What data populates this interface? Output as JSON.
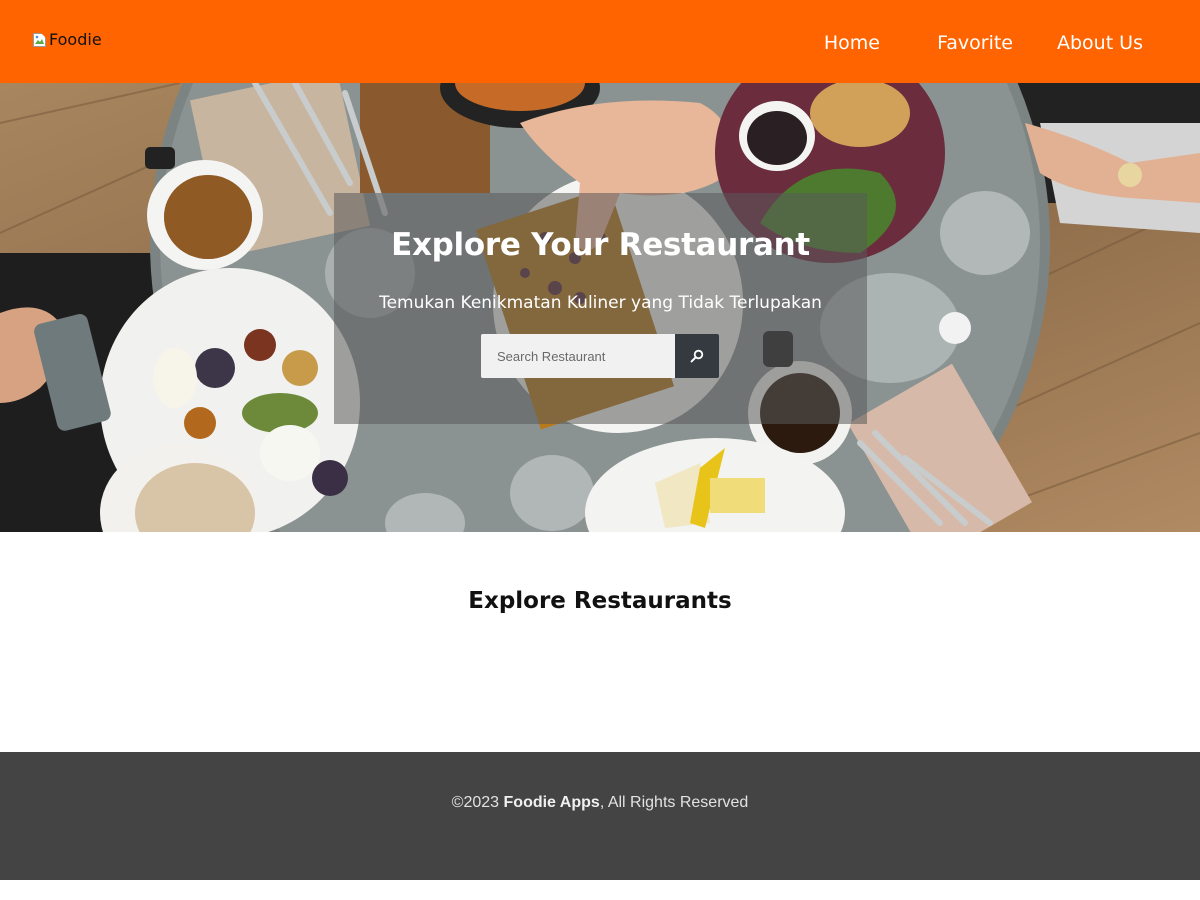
{
  "header": {
    "logo_alt": "Foodie",
    "nav": [
      {
        "label": "Home"
      },
      {
        "label": "Favorite"
      },
      {
        "label": "About Us"
      }
    ]
  },
  "hero": {
    "title": "Explore Your Restaurant",
    "subtitle": "Temukan Kenikmatan Kuliner yang Tidak Terlupakan",
    "search": {
      "placeholder": "Search Restaurant",
      "button_icon": "search-icon"
    }
  },
  "main": {
    "section_title": "Explore Restaurants"
  },
  "footer": {
    "copyright": "©2023",
    "brand": "Foodie Apps",
    "rights": ", All Rights Reserved"
  },
  "colors": {
    "header_bg": "#ff6400",
    "footer_bg": "#444444",
    "search_button_bg": "#343a40"
  }
}
